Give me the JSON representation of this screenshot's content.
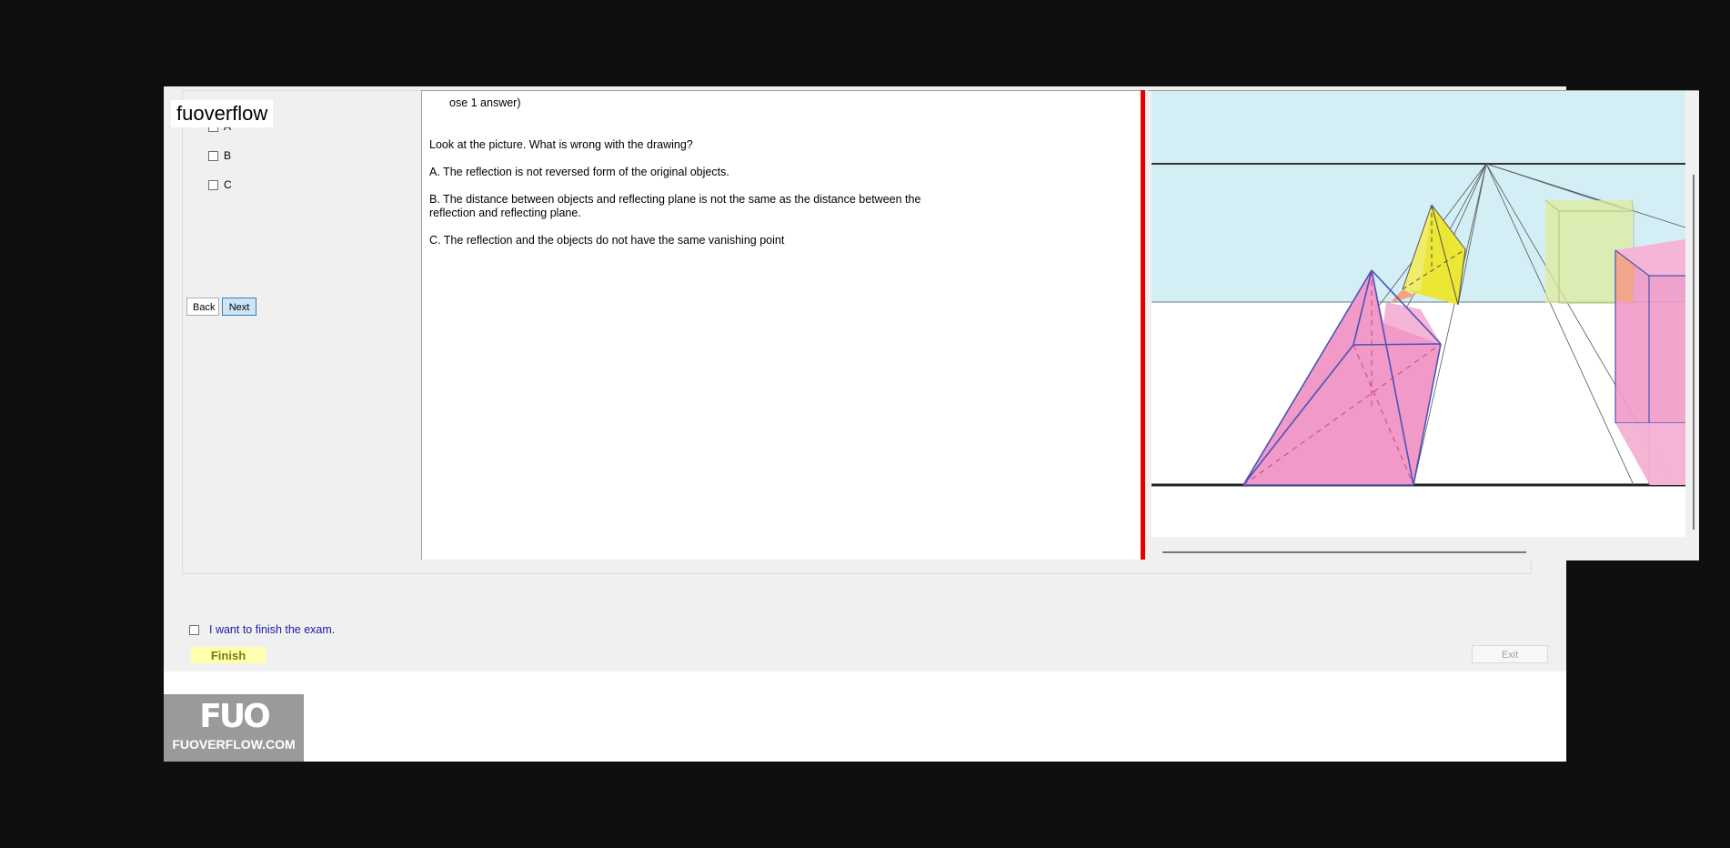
{
  "question": {
    "instruction_fragment": "ose 1 answer)",
    "prompt": "Look at the picture. What is wrong with the drawing?",
    "option_a": "A.  The reflection is not reversed form of the original objects.",
    "option_b_line1": "B.  The distance between objects and reflecting plane is not the same as the distance between the",
    "option_b_line2": "reflection and reflecting plane.",
    "option_c": "C.  The reflection and the objects do not have the same vanishing point"
  },
  "answers": [
    {
      "label": "A"
    },
    {
      "label": "B"
    },
    {
      "label": "C"
    }
  ],
  "nav": {
    "back_label": "Back",
    "next_label": "Next"
  },
  "watermark": "fuoverflow",
  "finish": {
    "checkbox_label": "I want to finish the exam.",
    "button_label": "Finish"
  },
  "exit_label": "Exit",
  "logo": {
    "mark": "FUO",
    "text": "FUOVERFLOW.COM"
  },
  "colors": {
    "splitter": "#e30000",
    "sky": "#d3eff5",
    "pyramid_pink": "#f19ac8",
    "pyramid_yellow": "#ece634",
    "cube_green": "#dfec9c",
    "outline_blue": "#4a52b8",
    "finish_bg": "#ffffb0",
    "next_bg": "#cde5f7"
  }
}
